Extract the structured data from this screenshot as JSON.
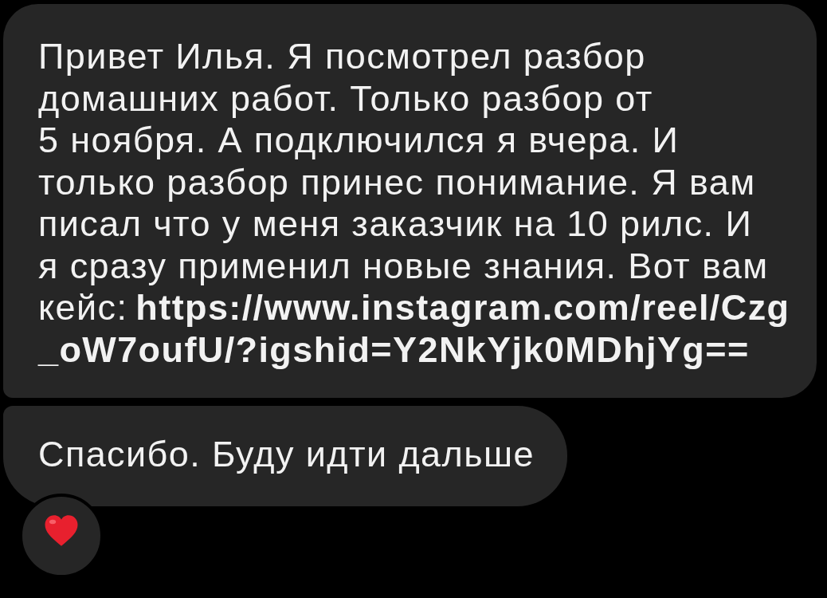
{
  "messages": [
    {
      "lines": [
        {
          "text": "Привет Илья. Я посмотрел разбор"
        },
        {
          "text": "домашних работ. Только разбор от"
        },
        {
          "text": "5 ноября. А подключился я вчера. И"
        },
        {
          "text": "только разбор принес понимание. Я вам"
        },
        {
          "text": "писал что у меня заказчик на 10 рилс. И"
        },
        {
          "text": "я сразу применил новые знания. Вот вам"
        },
        {
          "text": "кейс:",
          "link": "https://www.instagram.com/reel/Czg"
        },
        {
          "link": "_oW7oufU/?igshid=Y2NkYjk0MDhjYg=="
        }
      ]
    },
    {
      "lines": [
        {
          "text": "Спасибо. Буду идти дальше"
        }
      ],
      "reaction": {
        "kind": "heart"
      }
    }
  ]
}
